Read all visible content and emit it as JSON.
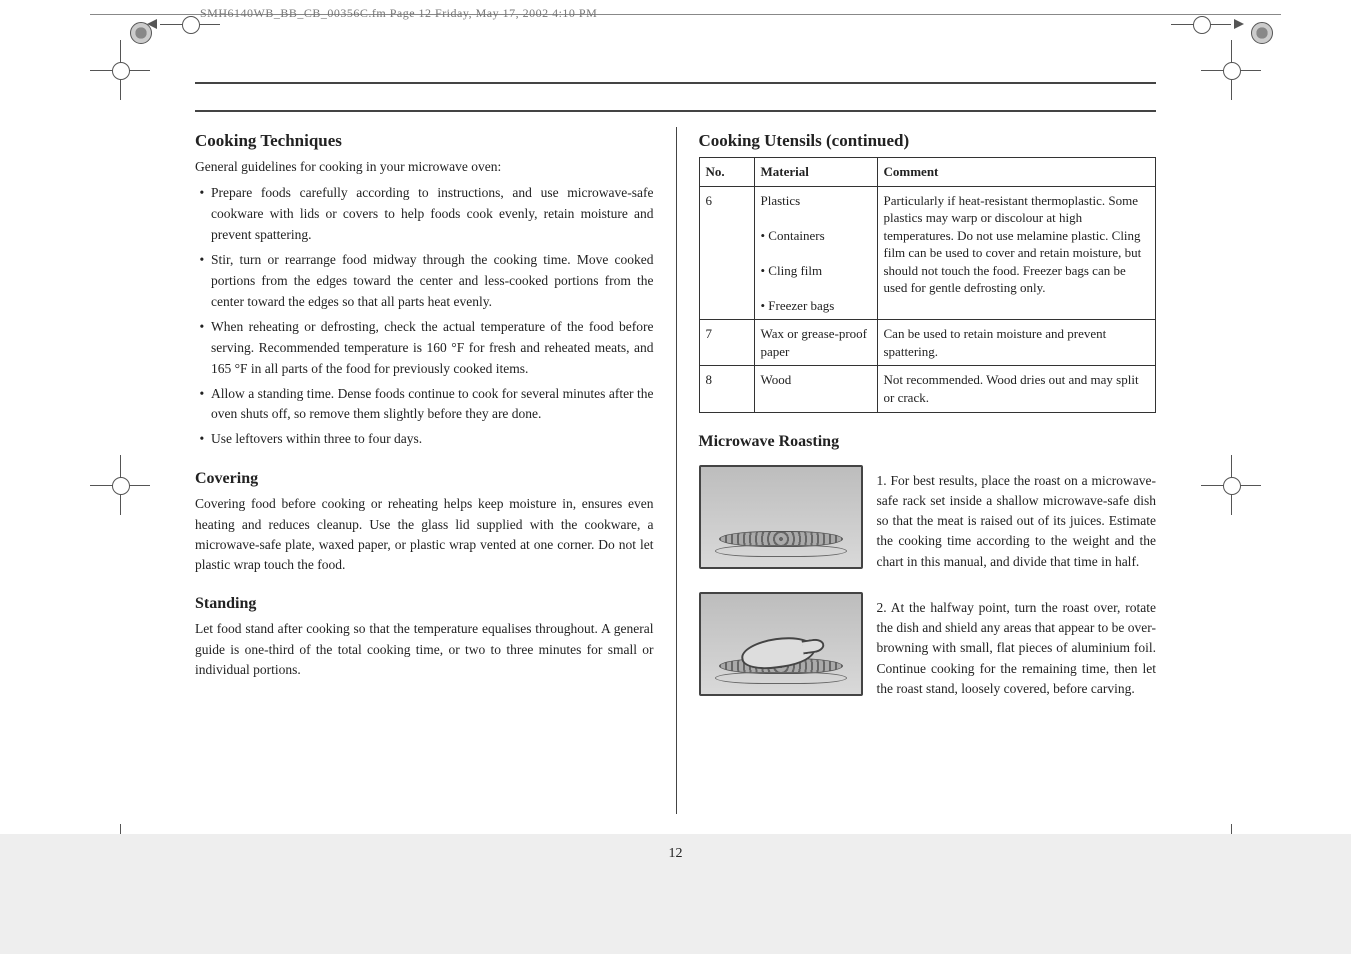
{
  "header": {
    "stamp": "SMH6140WB_BB_CB_00356C.fm  Page 12  Friday, May 17, 2002  4:10 PM"
  },
  "page_number": "12",
  "left": {
    "heading": "Cooking Techniques",
    "p1": "General guidelines for cooking in your microwave oven:",
    "bullets": [
      "Prepare foods carefully according to instructions, and use microwave-safe cookware with lids or covers to help foods cook evenly, retain moisture and prevent spattering.",
      "Stir, turn or rearrange food midway through the cooking time. Move cooked portions from the edges toward the center and less-cooked portions from the center toward the edges so that all parts heat evenly.",
      "When reheating or defrosting, check the actual temperature of the food before serving. Recommended temperature is 160 °F for fresh and reheated meats, and 165 °F in all parts of the food for previously cooked items.",
      "Allow a standing time. Dense foods continue to cook for several minutes after the oven shuts off, so remove them slightly before they are done.",
      "Use leftovers within three to four days."
    ],
    "sub1": "Covering",
    "p2": "Covering food before cooking or reheating helps keep moisture in, ensures even heating and reduces cleanup. Use the glass lid supplied with the cookware, a microwave-safe plate, waxed paper, or plastic wrap vented at one corner. Do not let plastic wrap touch the food.",
    "sub2": "Standing",
    "p3": "Let food stand after cooking so that the temperature equalises throughout. A general guide is one-third of the total cooking time, or two to three minutes for small or individual portions."
  },
  "right": {
    "heading": "Cooking Utensils (continued)",
    "table": {
      "headers": [
        "No.",
        "Material",
        "Comment"
      ],
      "rows": [
        {
          "no": "6",
          "mat": "Plastics\n\n• Containers\n\n• Cling film\n\n• Freezer bags",
          "comment": "Particularly if heat-resistant thermoplastic. Some plastics may warp or discolour at high temperatures. Do not use melamine plastic. Cling film can be used to cover and retain moisture, but should not touch the food. Freezer bags can be used for gentle defrosting only."
        },
        {
          "no": "7",
          "mat": "Wax or grease-proof paper",
          "comment": "Can be used to retain moisture and prevent spattering."
        },
        {
          "no": "8",
          "mat": "Wood",
          "comment": "Not recommended. Wood dries out and may split or crack."
        }
      ]
    },
    "sub1": "Microwave Roasting",
    "fig1_caption": "1. For best results, place the roast on a microwave-safe rack set inside a shallow microwave-safe dish so that the meat is raised out of its juices. Estimate the cooking time according to the weight and the chart in this manual, and divide that time in half.",
    "fig2_caption": "2. At the halfway point, turn the roast over, rotate the dish and shield any areas that appear to be over-browning with small, flat pieces of aluminium foil. Continue cooking for the remaining time, then let the roast stand, loosely covered, before carving."
  }
}
